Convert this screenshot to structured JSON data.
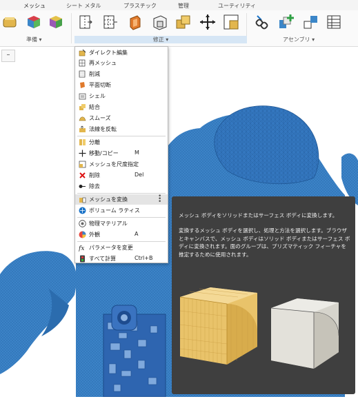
{
  "tabs": [
    "メッシュ",
    "シート メタル",
    "プラスチック",
    "管理",
    "ユーティリティ"
  ],
  "active_tab": "メッシュ",
  "groups": {
    "prepare": "準備 ▾",
    "modify": "修正 ▾",
    "assembly": "アセンブリ ▾"
  },
  "canvas": {
    "collapse_button": "–"
  },
  "menu": {
    "items": [
      {
        "label": "ダイレクト編集",
        "shortcut": "",
        "icon": "direct-edit-icon"
      },
      {
        "label": "再メッシュ",
        "shortcut": "",
        "icon": "remesh-icon"
      },
      {
        "label": "削減",
        "shortcut": "",
        "icon": "reduce-icon"
      },
      {
        "label": "平面切断",
        "shortcut": "",
        "icon": "plane-cut-icon"
      },
      {
        "label": "シェル",
        "shortcut": "",
        "icon": "shell-icon"
      },
      {
        "label": "結合",
        "shortcut": "",
        "icon": "combine-icon"
      },
      {
        "label": "スムーズ",
        "shortcut": "",
        "icon": "smooth-icon"
      },
      {
        "label": "法線を反転",
        "shortcut": "",
        "icon": "reverse-normal-icon"
      },
      {
        "label": "分離",
        "shortcut": "",
        "icon": "separate-icon"
      },
      {
        "label": "移動/コピー",
        "shortcut": "M",
        "icon": "move-icon"
      },
      {
        "label": "メッシュを尺度指定",
        "shortcut": "",
        "icon": "scale-mesh-icon"
      },
      {
        "label": "削除",
        "shortcut": "Del",
        "icon": "delete-icon"
      },
      {
        "label": "除去",
        "shortcut": "",
        "icon": "remove-icon"
      },
      {
        "label": "メッシュを変換",
        "shortcut": "",
        "icon": "convert-mesh-icon"
      },
      {
        "label": "ボリューム ラティス",
        "shortcut": "",
        "icon": "volume-lattice-icon"
      },
      {
        "label": "物理マテリアル",
        "shortcut": "",
        "icon": "physical-material-icon"
      },
      {
        "label": "外観",
        "shortcut": "A",
        "icon": "appearance-icon"
      },
      {
        "label": "パラメータを変更",
        "shortcut": "",
        "icon": "change-parameters-icon"
      },
      {
        "label": "すべて計算",
        "shortcut": "Ctrl+B",
        "icon": "compute-all-icon"
      }
    ]
  },
  "tooltip": {
    "title": "メッシュ ボディをソリッドまたはサーフェス ボディに変換します。",
    "body": "変換するメッシュ ボディを選択し、処理と方法を選択します。ブラウザとキャンバスで、メッシュ ボディはソリッド ボディまたはサーフェス ボディに変換されます。面のグループは、プリズマティック フィーチャを推定するために使用されます。"
  },
  "colors": {
    "mesh_blue": "#3c83c7",
    "tooltip_bg": "#3f3f3f",
    "accent": "#0a68b4"
  }
}
